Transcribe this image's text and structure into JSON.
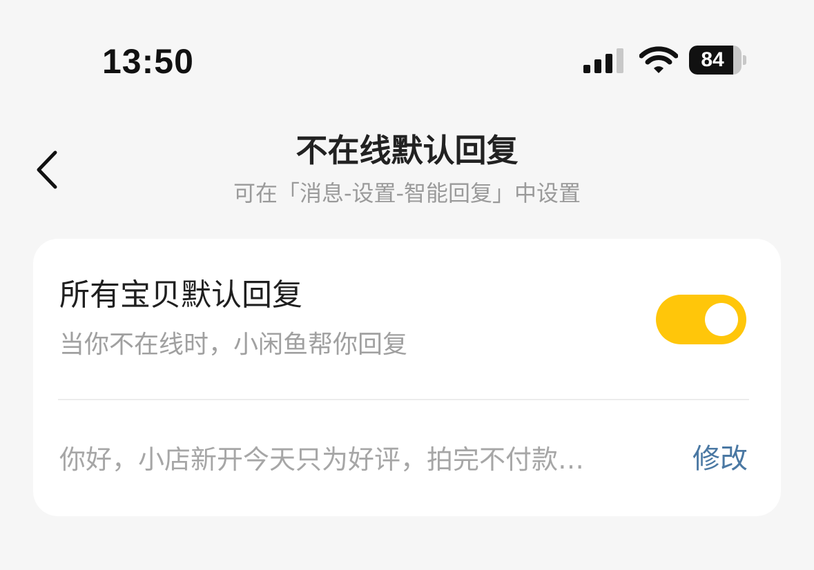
{
  "status_bar": {
    "time": "13:50",
    "battery_level": "84",
    "icons": [
      "cellular-signal-icon",
      "wifi-icon",
      "battery-icon"
    ]
  },
  "nav": {
    "back_icon": "chevron-left-icon",
    "title": "不在线默认回复",
    "subtitle": "可在「消息-设置-智能回复」中设置"
  },
  "card": {
    "setting": {
      "title": "所有宝贝默认回复",
      "description": "当你不在线时，小闲鱼帮你回复",
      "enabled": true
    },
    "reply": {
      "text": "你好，小店新开今天只为好评，拍完不付款…",
      "edit_label": "修改"
    }
  },
  "colors": {
    "background": "#f6f6f6",
    "card": "#ffffff",
    "toggle_on": "#ffc60a",
    "link": "#4a78a3",
    "secondary_text": "#a0a0a0"
  }
}
